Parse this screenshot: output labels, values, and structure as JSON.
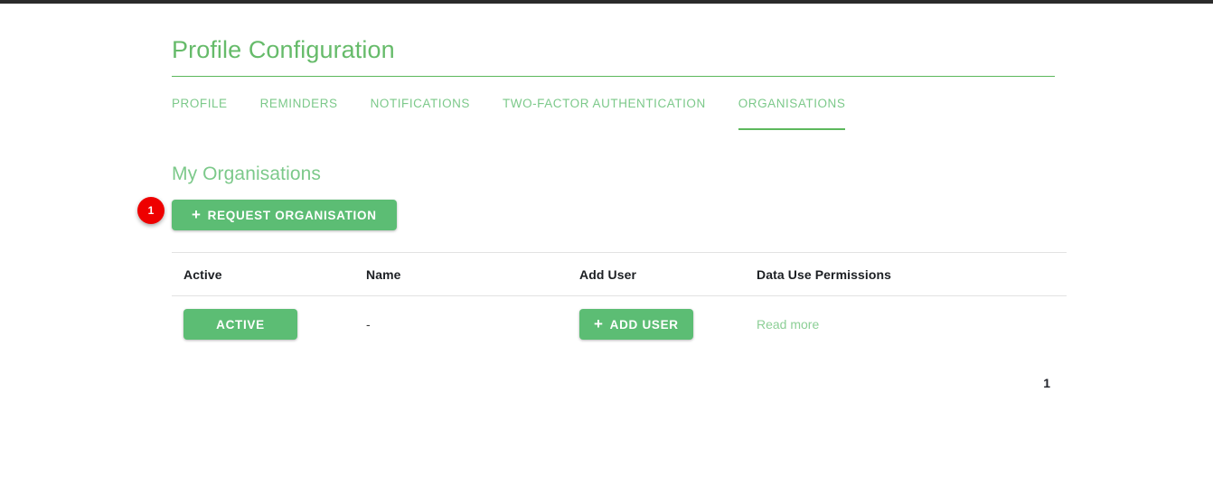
{
  "header": {
    "title": "Profile Configuration"
  },
  "tabs": [
    {
      "label": "PROFILE",
      "active": false
    },
    {
      "label": "REMINDERS",
      "active": false
    },
    {
      "label": "NOTIFICATIONS",
      "active": false
    },
    {
      "label": "TWO-FACTOR AUTHENTICATION",
      "active": false
    },
    {
      "label": "ORGANISATIONS",
      "active": true
    }
  ],
  "section": {
    "heading": "My Organisations",
    "request_button": {
      "icon": "plus-icon",
      "plus": "+",
      "label": "REQUEST ORGANISATION"
    },
    "marker": "1"
  },
  "table": {
    "columns": [
      "Active",
      "Name",
      "Add User",
      "Data Use Permissions"
    ],
    "rows": [
      {
        "active_label": "ACTIVE",
        "name": "-",
        "add_user": {
          "plus": "+",
          "label": "ADD USER"
        },
        "permissions_link": "Read more"
      }
    ]
  },
  "pagination": {
    "current_page": "1"
  },
  "colors": {
    "primary_green": "#5cbd74",
    "tab_green": "#7cc98a",
    "title_green": "#66bb6a",
    "link_green": "#8ccf96",
    "marker_red": "#ee0000",
    "rule_gray": "#e2e2e2",
    "top_bar": "#2b2b2b"
  }
}
